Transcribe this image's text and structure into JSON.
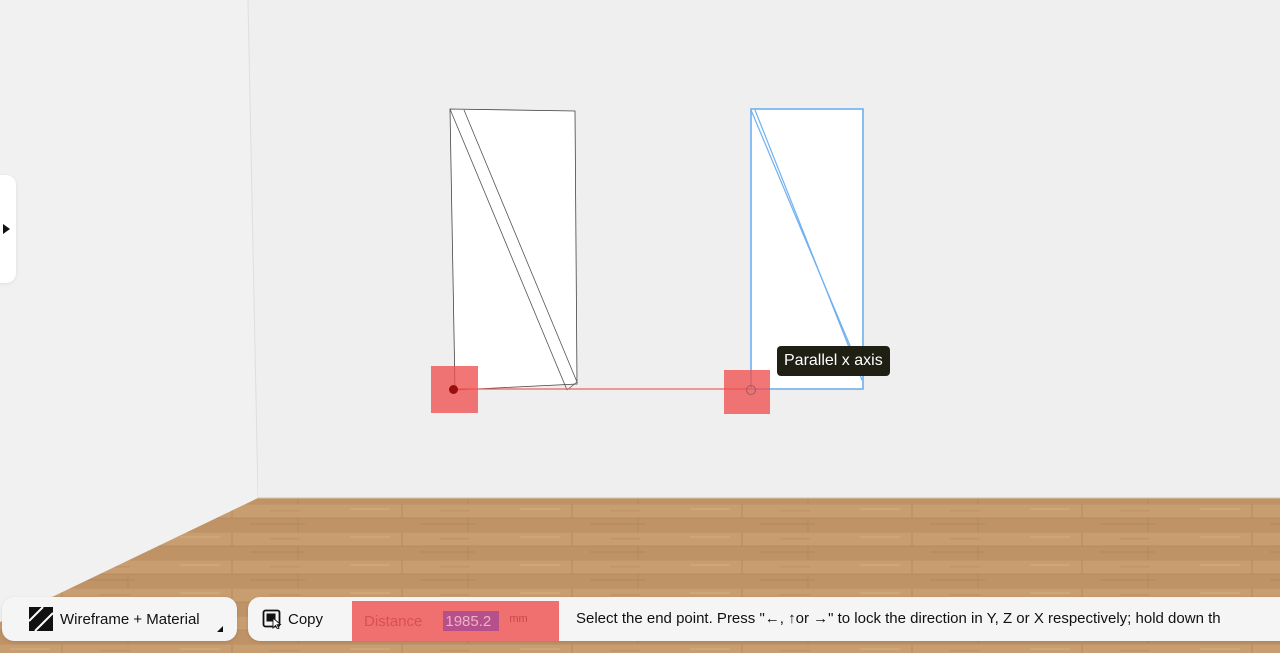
{
  "colors": {
    "wall": "#efefef",
    "selection_blue": "#6fb0f0",
    "snap_red": "#f05050",
    "guide_line": "#f06060",
    "floor_base": "#c49a6c"
  },
  "viewport": {
    "side_panel_toggle_icon": "triangle-right-icon"
  },
  "tooltip": {
    "text": "Parallel x axis"
  },
  "bottom_bar": {
    "mode": {
      "icon": "wireframe-material-icon",
      "label": "Wireframe + Material",
      "caret_icon": "dropdown-corner-icon"
    },
    "copy": {
      "icon": "copy-cursor-icon",
      "label": "Copy"
    },
    "distance": {
      "label": "Distance",
      "value": "1985.2",
      "unit": "mm"
    },
    "status": "Select the end point. Press \"←, ↑or →\" to lock the direction in Y, Z or X respectively; hold down th"
  }
}
